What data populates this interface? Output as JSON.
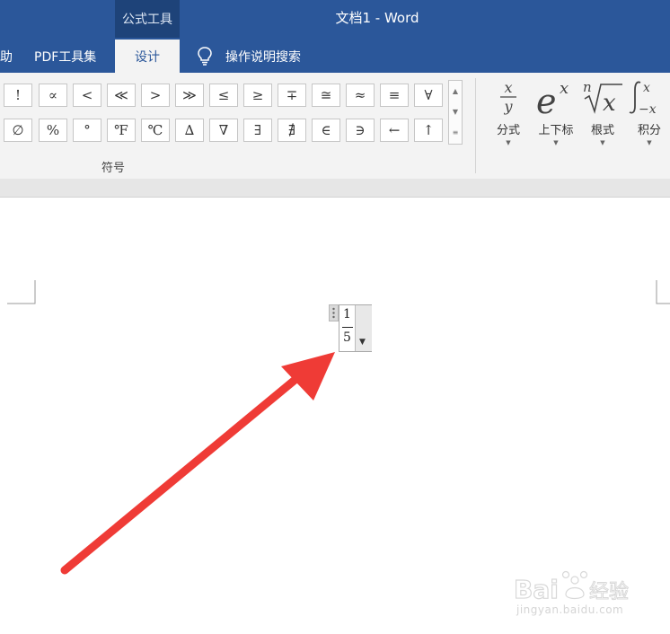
{
  "titlebar": {
    "context_group": "公式工具",
    "document_title": "文档1  -  Word"
  },
  "tabs": [
    {
      "label": "助"
    },
    {
      "label": "PDF工具集"
    },
    {
      "label": "设计",
      "active": true
    }
  ],
  "tell_me": {
    "label": "操作说明搜索",
    "icon": "lightbulb-icon"
  },
  "symbols": {
    "row1": [
      "!",
      "∝",
      "<",
      "≪",
      ">",
      "≫",
      "≤",
      "≥",
      "∓",
      "≅",
      "≈",
      "≡",
      "∀"
    ],
    "row2": [
      "∅",
      "%",
      "°",
      "℉",
      "℃",
      "∆",
      "∇",
      "∃",
      "∄",
      "∈",
      "∋",
      "←",
      "↑"
    ],
    "group_label": "符号"
  },
  "structures": [
    {
      "label": "分式",
      "icon": "fraction-icon",
      "glyph_num": "x",
      "glyph_den": "y"
    },
    {
      "label": "上下标",
      "icon": "script-icon",
      "glyph_base": "e",
      "glyph_sup": "x"
    },
    {
      "label": "根式",
      "icon": "radical-icon",
      "glyph_index": "n",
      "glyph_base": "x"
    },
    {
      "label": "积分",
      "icon": "integral-icon",
      "glyph_sup": "x",
      "glyph_sub": "−x"
    }
  ],
  "equation": {
    "numerator": "1",
    "denominator": "5"
  },
  "watermark": {
    "brand": "Bai  经验",
    "url": "jingyan.baidu.com"
  },
  "colors": {
    "word_blue": "#2b579a",
    "context_blue": "#1e4379",
    "arrow_red": "#ef3b36"
  }
}
